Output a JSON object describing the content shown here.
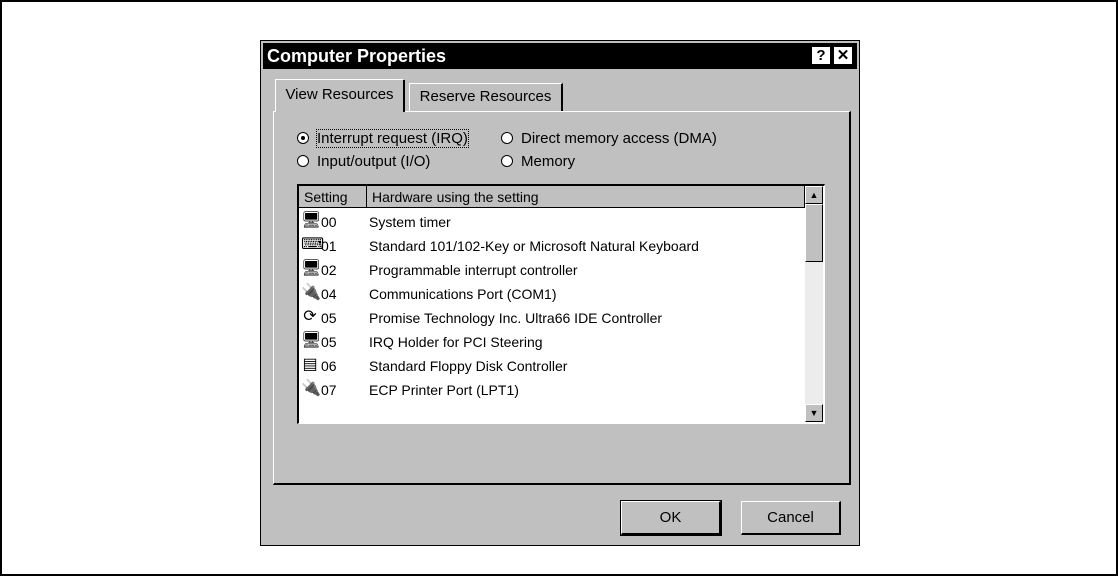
{
  "window": {
    "title": "Computer Properties",
    "help_label": "?",
    "close_label": "✕"
  },
  "tabs": [
    {
      "label": "View Resources",
      "active": true
    },
    {
      "label": "Reserve Resources",
      "active": false
    }
  ],
  "resource_types": [
    {
      "label": "Interrupt request (IRQ)",
      "selected": true
    },
    {
      "label": "Direct memory access (DMA)",
      "selected": false
    },
    {
      "label": "Input/output (I/O)",
      "selected": false
    },
    {
      "label": "Memory",
      "selected": false
    }
  ],
  "list": {
    "columns": [
      "Setting",
      "Hardware using the setting"
    ],
    "rows": [
      {
        "icon": "computer-icon",
        "glyph": "🖥",
        "setting": "00",
        "hardware": "System timer"
      },
      {
        "icon": "keyboard-icon",
        "glyph": "⌨",
        "setting": "01",
        "hardware": "Standard 101/102-Key or Microsoft Natural Keyboard"
      },
      {
        "icon": "computer-icon",
        "glyph": "🖥",
        "setting": "02",
        "hardware": "Programmable interrupt controller"
      },
      {
        "icon": "port-icon",
        "glyph": "🔌",
        "setting": "04",
        "hardware": "Communications Port (COM1)"
      },
      {
        "icon": "disk-controller-icon",
        "glyph": "⟳",
        "setting": "05",
        "hardware": "Promise Technology Inc. Ultra66 IDE Controller"
      },
      {
        "icon": "computer-icon",
        "glyph": "🖥",
        "setting": "05",
        "hardware": "IRQ Holder for PCI Steering"
      },
      {
        "icon": "floppy-controller-icon",
        "glyph": "▤",
        "setting": "06",
        "hardware": "Standard Floppy Disk Controller"
      },
      {
        "icon": "port-icon",
        "glyph": "🔌",
        "setting": "07",
        "hardware": "ECP Printer Port (LPT1)"
      }
    ],
    "scroll_up": "▲",
    "scroll_down": "▼"
  },
  "buttons": {
    "ok": "OK",
    "cancel": "Cancel"
  }
}
